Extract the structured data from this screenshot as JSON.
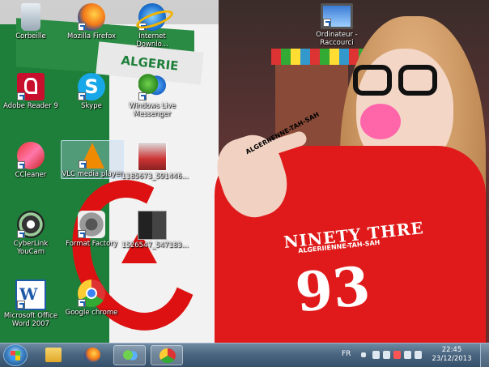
{
  "desktop": {
    "icons": [
      {
        "label": "Corbeille"
      },
      {
        "label": "Mozilla Firefox"
      },
      {
        "label": "Internet Downlo..."
      },
      {
        "label": "Ordinateur - Raccourci"
      },
      {
        "label": "Adobe Reader 9"
      },
      {
        "label": "Skype"
      },
      {
        "label": "Windows Live Messenger"
      },
      {
        "label": "CCleaner"
      },
      {
        "label": "VLC media player"
      },
      {
        "label": "1185673_591446..."
      },
      {
        "label": "CyberLink YouCam"
      },
      {
        "label": "Format Factory"
      },
      {
        "label": "1526547_547183..."
      },
      {
        "label": "Microsoft Office Word 2007"
      },
      {
        "label": "Google chrome"
      }
    ],
    "wallpaper_text": {
      "banner": "ALGERIE",
      "signature": "ALGERIIENNE-TAH-SAH",
      "hoodie_top": "NINETY THRE",
      "hoodie_sub": "ALGERIIENNE-TAH-SAH",
      "hoodie_num": "93"
    }
  },
  "taskbar": {
    "language": "FR",
    "time": "22:45",
    "date": "23/12/2013",
    "pinned": [
      "explorer-icon",
      "firefox-icon",
      "messenger-icon",
      "chrome-icon"
    ]
  }
}
